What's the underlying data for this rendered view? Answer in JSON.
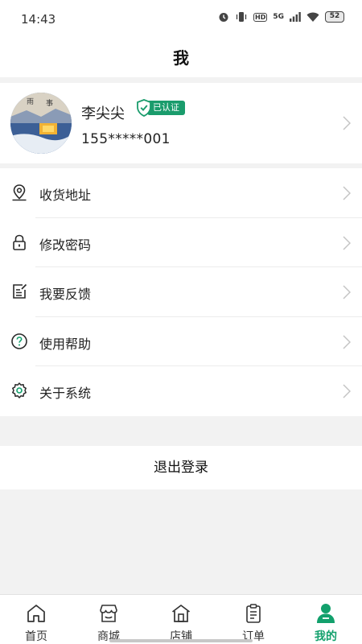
{
  "status": {
    "time": "14:43",
    "network": "5G",
    "hd": "HD",
    "battery": "52"
  },
  "header": {
    "title": "我"
  },
  "profile": {
    "name": "李尖尖",
    "badge": "已认证",
    "phone": "155*****001"
  },
  "menu": [
    {
      "label": "收货地址",
      "icon": "location-pin-icon"
    },
    {
      "label": "修改密码",
      "icon": "lock-icon"
    },
    {
      "label": "我要反馈",
      "icon": "feedback-icon"
    },
    {
      "label": "使用帮助",
      "icon": "help-icon"
    },
    {
      "label": "关于系统",
      "icon": "gear-icon"
    }
  ],
  "logout": {
    "label": "退出登录"
  },
  "tabs": [
    {
      "label": "首页",
      "icon": "home-icon"
    },
    {
      "label": "商城",
      "icon": "store-icon"
    },
    {
      "label": "店铺",
      "icon": "shop-icon"
    },
    {
      "label": "订单",
      "icon": "order-icon"
    },
    {
      "label": "我的",
      "icon": "profile-icon",
      "active": true
    }
  ],
  "colors": {
    "accent": "#12a06c",
    "badge": "#1a9c6c",
    "background": "#f2f2f2"
  }
}
